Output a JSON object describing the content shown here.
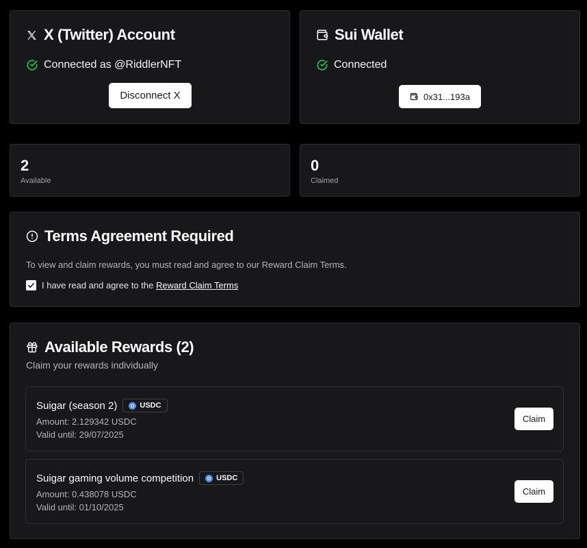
{
  "twitter": {
    "title": "X (Twitter) Account",
    "icon": "x-logo-icon",
    "status": "Connected as @RiddlerNFT",
    "disconnect_label": "Disconnect X"
  },
  "wallet": {
    "title": "Sui Wallet",
    "icon": "wallet-icon",
    "status": "Connected",
    "address_label": "0x31...193a"
  },
  "stats": {
    "available": {
      "value": "2",
      "label": "Available"
    },
    "claimed": {
      "value": "0",
      "label": "Claimed"
    }
  },
  "terms": {
    "title": "Terms Agreement Required",
    "description": "To view and claim rewards, you must read and agree to our Reward Claim Terms.",
    "checkbox_text": "I have read and agree to the ",
    "link_text": "Reward Claim Terms",
    "checked": true
  },
  "rewards": {
    "title": "Available Rewards (2)",
    "subtitle": "Claim your rewards individually",
    "items": [
      {
        "name": "Suigar (season 2)",
        "token": "USDC",
        "amount": "Amount: 2.129342 USDC",
        "valid": "Valid until: 29/07/2025",
        "claim_label": "Claim"
      },
      {
        "name": "Suigar gaming volume competition",
        "token": "USDC",
        "amount": "Amount: 0.438078 USDC",
        "valid": "Valid until: 01/10/2025",
        "claim_label": "Claim"
      }
    ]
  },
  "colors": {
    "background": "#000000",
    "card": "#18181b",
    "border": "#2e2e33",
    "success": "#22c55e",
    "token": "#4f8ef7"
  }
}
